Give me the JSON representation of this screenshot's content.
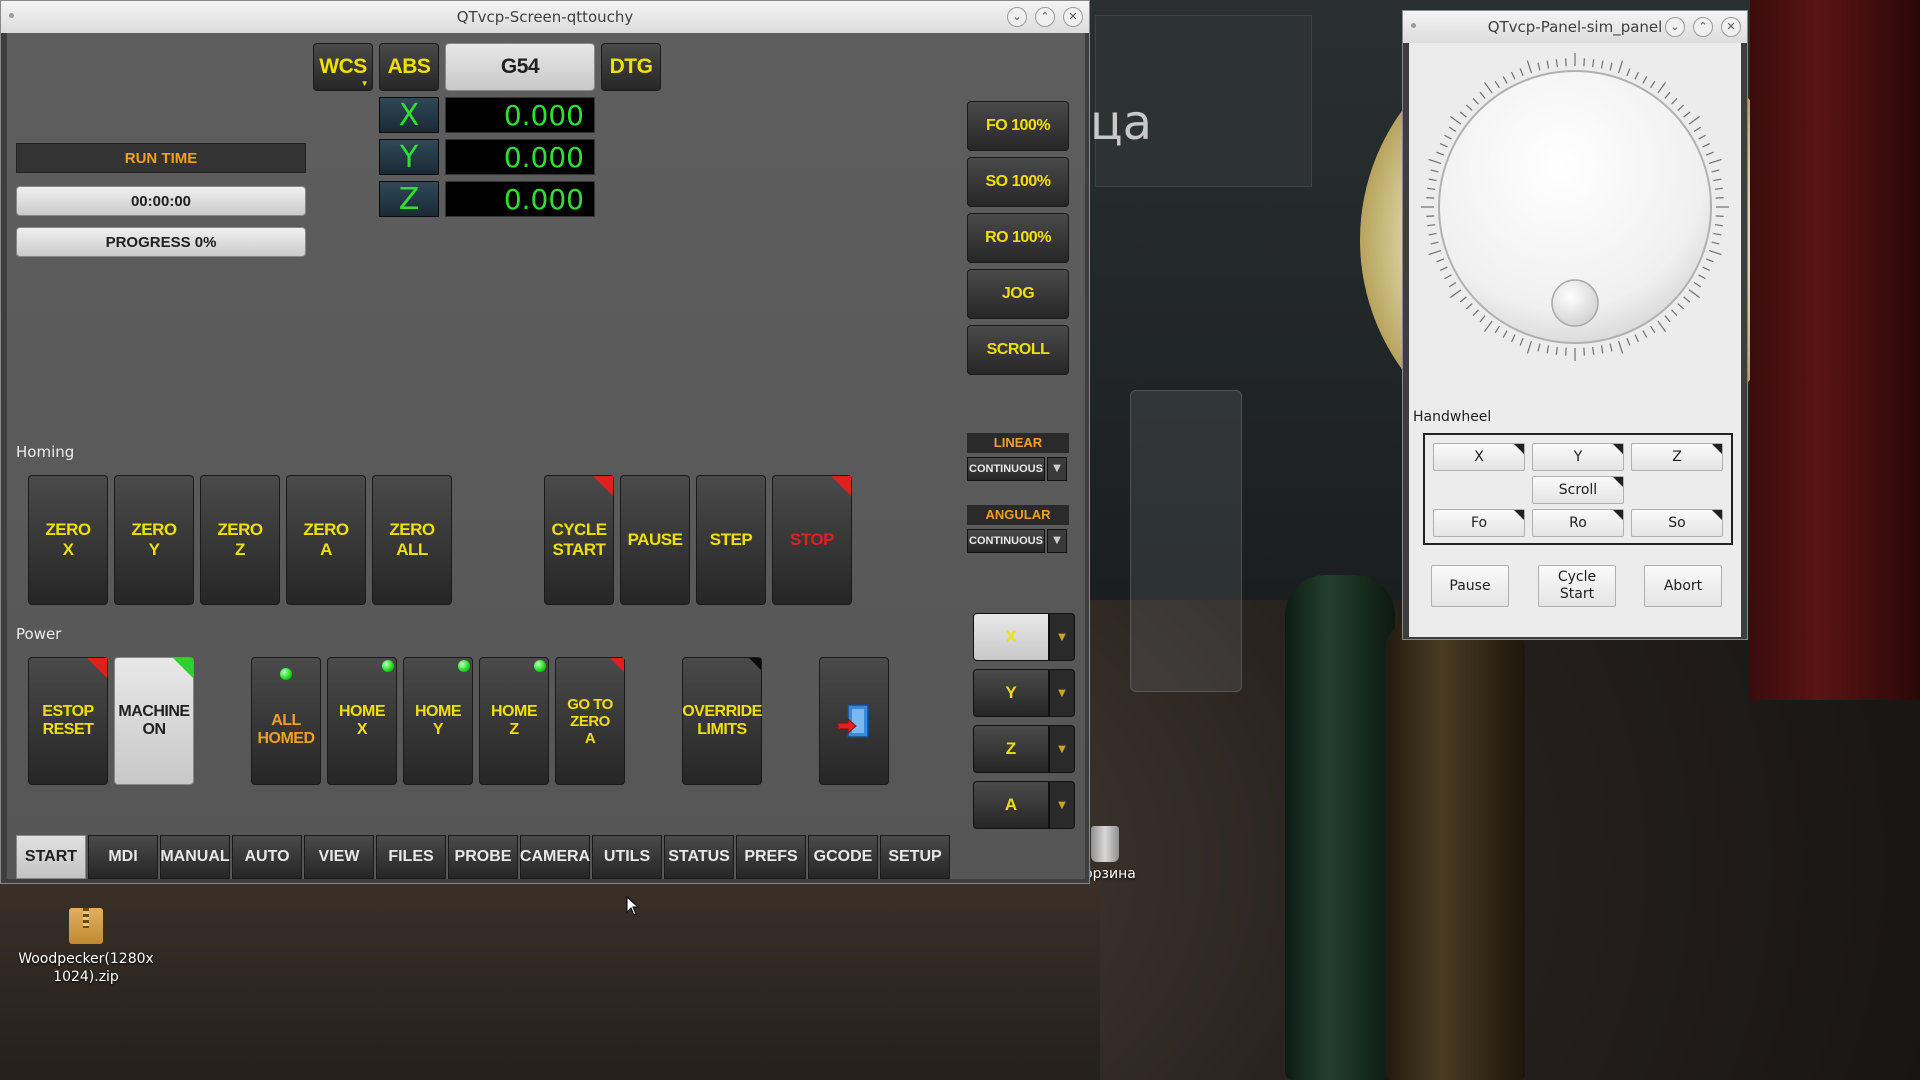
{
  "desktop": {
    "background_text": "ца",
    "icons": [
      {
        "label": "Woodpecker(1280x1024).zip"
      },
      {
        "label": "Корзина"
      }
    ]
  },
  "main_window": {
    "title": "QTvcp-Screen-qttouchy",
    "top_buttons": {
      "wcs": "WCS",
      "abs": "ABS",
      "g54": "G54",
      "dtg": "DTG"
    },
    "dro": [
      {
        "axis": "X",
        "value": "0.000"
      },
      {
        "axis": "Y",
        "value": "0.000"
      },
      {
        "axis": "Z",
        "value": "0.000"
      }
    ],
    "status": {
      "run_time_label": "RUN TIME",
      "run_time_value": "00:00:00",
      "progress": "PROGRESS 0%"
    },
    "overrides": [
      "FO 100%",
      "SO 100%",
      "RO 100%",
      "JOG",
      "SCROLL"
    ],
    "homing_label": "Homing",
    "zero_buttons": [
      {
        "line1": "ZERO",
        "line2": "X"
      },
      {
        "line1": "ZERO",
        "line2": "Y"
      },
      {
        "line1": "ZERO",
        "line2": "Z"
      },
      {
        "line1": "ZERO",
        "line2": "A"
      },
      {
        "line1": "ZERO",
        "line2": "ALL"
      }
    ],
    "cycle": {
      "cycle_start_1": "CYCLE",
      "cycle_start_2": "START",
      "pause": "PAUSE",
      "step": "STEP",
      "stop": "STOP"
    },
    "linear": {
      "title": "LINEAR",
      "value": "CONTINUOUS"
    },
    "angular": {
      "title": "ANGULAR",
      "value": "CONTINUOUS"
    },
    "power_label": "Power",
    "power_buttons": {
      "estop_1": "ESTOP",
      "estop_2": "RESET",
      "machine_1": "MACHINE",
      "machine_2": "ON",
      "all_homed_1": "ALL",
      "all_homed_2": "HOMED",
      "home_x_1": "HOME",
      "home_x_2": "X",
      "home_y_1": "HOME",
      "home_y_2": "Y",
      "home_z_1": "HOME",
      "home_z_2": "Z",
      "goto_zero_1": "GO TO",
      "goto_zero_2": "ZERO",
      "goto_zero_3": "A",
      "override_1": "OVERRIDE",
      "override_2": "LIMITS"
    },
    "jog_axes": [
      "X",
      "Y",
      "Z",
      "A"
    ],
    "tabs": [
      "START",
      "MDI",
      "MANUAL",
      "AUTO",
      "VIEW",
      "FILES",
      "PROBE",
      "CAMERA",
      "UTILS",
      "STATUS",
      "PREFS",
      "GCODE",
      "SETUP"
    ],
    "active_tab": "START",
    "colors": {
      "accent_yellow": "#f0e000",
      "accent_orange": "#f0a020",
      "dro_green": "#30e030",
      "stop_red": "#e02020"
    }
  },
  "sim_panel": {
    "title": "QTvcp-Panel-sim_panel",
    "handwheel_label": "Handwheel",
    "axis_buttons": [
      "X",
      "Y",
      "Z"
    ],
    "scroll": "Scroll",
    "rate_buttons": [
      "Fo",
      "Ro",
      "So"
    ],
    "bottom_buttons": {
      "pause": "Pause",
      "cycle_start_1": "Cycle",
      "cycle_start_2": "Start",
      "abort": "Abort"
    }
  }
}
